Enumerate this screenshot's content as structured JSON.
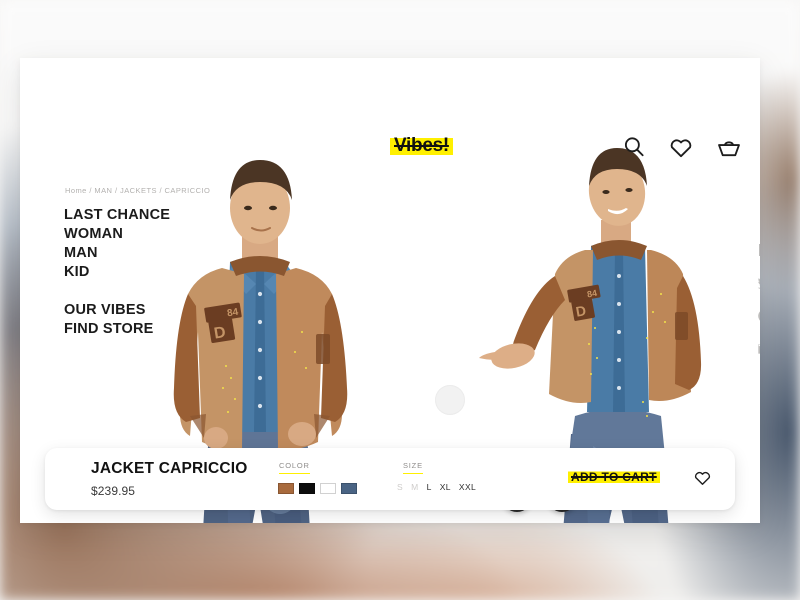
{
  "header": {
    "logo": "Vibes!",
    "icons": [
      {
        "name": "search-icon",
        "label": "Search"
      },
      {
        "name": "heart-icon",
        "label": "Wishlist"
      },
      {
        "name": "basket-icon",
        "label": "Cart"
      }
    ]
  },
  "breadcrumb": "Home / MAN / JACKETS / CAPRICCIO",
  "nav": {
    "primary": [
      "LAST CHANCE",
      "WOMAN",
      "MAN",
      "KID"
    ],
    "secondary": [
      "OUR VIBES",
      "FIND STORE"
    ]
  },
  "carousel": {
    "prev_label": "‹",
    "next_label": "›"
  },
  "social": [
    {
      "name": "facebook-icon",
      "label": "Facebook"
    },
    {
      "name": "twitter-icon",
      "label": "Twitter"
    },
    {
      "name": "pinterest-icon",
      "label": "Pinterest"
    },
    {
      "name": "email-icon",
      "label": "Email"
    }
  ],
  "product": {
    "title": "JACKET CAPRICCIO",
    "price": "$239.95",
    "color_label": "COLOR",
    "size_label": "SIZE",
    "colors": [
      {
        "name": "tan",
        "hex": "#a86a3d",
        "selected": true
      },
      {
        "name": "black",
        "hex": "#0d0d0d",
        "selected": false
      },
      {
        "name": "white",
        "hex": "#ffffff",
        "selected": false
      },
      {
        "name": "blue",
        "hex": "#4a6484",
        "selected": false
      }
    ],
    "sizes": [
      {
        "label": "S",
        "available": false
      },
      {
        "label": "M",
        "available": false
      },
      {
        "label": "L",
        "available": true
      },
      {
        "label": "XL",
        "available": true
      },
      {
        "label": "XXL",
        "available": true
      }
    ],
    "add_to_cart": "ADD TO CART",
    "wishlist_icon": "heart-icon"
  },
  "colors": {
    "accent": "#fff000",
    "text": "#121212",
    "muted": "#b3b1af",
    "arrow_bg": "#2b2b2b",
    "card_bg": "#ffffff"
  }
}
